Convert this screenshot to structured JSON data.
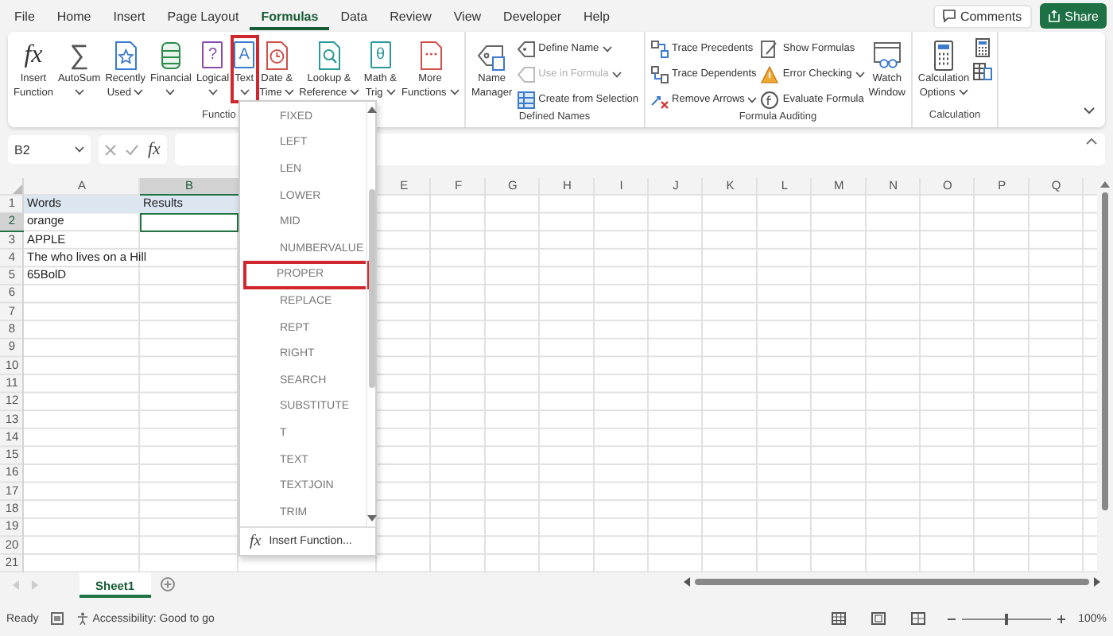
{
  "menu_tabs": [
    {
      "label": "File",
      "selected": false
    },
    {
      "label": "Home",
      "selected": false
    },
    {
      "label": "Insert",
      "selected": false
    },
    {
      "label": "Page Layout",
      "selected": false
    },
    {
      "label": "Formulas",
      "selected": true
    },
    {
      "label": "Data",
      "selected": false
    },
    {
      "label": "Review",
      "selected": false
    },
    {
      "label": "View",
      "selected": false
    },
    {
      "label": "Developer",
      "selected": false
    },
    {
      "label": "Help",
      "selected": false
    }
  ],
  "comments_button": "Comments",
  "share_button": "Share",
  "ribbon": {
    "groups": [
      {
        "label": "Functio",
        "items": [
          {
            "kind": "large",
            "icon_text": "fx",
            "lines": [
              "Insert",
              "Function"
            ],
            "dropdown": false,
            "highlighted": false
          },
          {
            "kind": "large",
            "icon_text": "∑",
            "lines": [
              "AutoSum"
            ],
            "dropdown": true,
            "highlighted": false
          },
          {
            "kind": "large",
            "lines": [
              "Recently",
              "Used"
            ],
            "dropdown": true,
            "highlighted": false
          },
          {
            "kind": "large",
            "lines": [
              "Financial"
            ],
            "dropdown": true,
            "highlighted": false
          },
          {
            "kind": "large",
            "icon_text": "?",
            "lines": [
              "Logical"
            ],
            "dropdown": true,
            "highlighted": false
          },
          {
            "kind": "large",
            "icon_text": "A",
            "lines": [
              "Text"
            ],
            "dropdown": true,
            "highlighted": true
          },
          {
            "kind": "large",
            "lines": [
              "Date &",
              "Time"
            ],
            "dropdown": true,
            "highlighted": false
          },
          {
            "kind": "large",
            "lines": [
              "Lookup &",
              "Reference"
            ],
            "dropdown": true,
            "highlighted": false
          },
          {
            "kind": "large",
            "icon_text": "θ",
            "lines": [
              "Math &",
              "Trig"
            ],
            "dropdown": true,
            "highlighted": false
          },
          {
            "kind": "large",
            "lines": [
              "More",
              "Functions"
            ],
            "dropdown": true,
            "highlighted": false
          }
        ]
      },
      {
        "label": "Defined Names",
        "items": [
          {
            "kind": "large",
            "lines": [
              "Name",
              "Manager"
            ],
            "dropdown": false,
            "highlighted": false
          },
          {
            "kind": "small",
            "label": "Define Name",
            "dropdown": true,
            "disabled": false
          },
          {
            "kind": "small",
            "label": "Use in Formula",
            "dropdown": true,
            "disabled": true
          },
          {
            "kind": "small",
            "label": "Create from Selection",
            "dropdown": false,
            "disabled": false
          }
        ]
      },
      {
        "label": "Formula Auditing",
        "items": [
          {
            "kind": "small",
            "label": "Trace Precedents",
            "dropdown": false,
            "disabled": false
          },
          {
            "kind": "small",
            "label": "Trace Dependents",
            "dropdown": false,
            "disabled": false
          },
          {
            "kind": "small",
            "label": "Remove Arrows",
            "dropdown": true,
            "disabled": false
          },
          {
            "kind": "small",
            "label": "Show Formulas",
            "dropdown": false,
            "disabled": false
          },
          {
            "kind": "small",
            "label": "Error Checking",
            "dropdown": true,
            "disabled": false
          },
          {
            "kind": "small",
            "label": "Evaluate Formula",
            "dropdown": false,
            "disabled": false
          },
          {
            "kind": "large",
            "lines": [
              "Watch",
              "Window"
            ],
            "dropdown": false,
            "highlighted": false
          }
        ]
      },
      {
        "label": "Calculation",
        "items": [
          {
            "kind": "large",
            "lines": [
              "Calculation",
              "Options"
            ],
            "dropdown": true,
            "highlighted": false
          },
          {
            "kind": "icon"
          },
          {
            "kind": "icon"
          }
        ]
      }
    ]
  },
  "formula_bar": {
    "name_box": "B2",
    "fx": "fx"
  },
  "sheet": {
    "columns": [
      "A",
      "B",
      "E",
      "F",
      "G",
      "H",
      "I",
      "J",
      "K",
      "L",
      "M",
      "N",
      "O",
      "P",
      "Q"
    ],
    "rows": [
      {
        "number": "1",
        "cells": [
          {
            "text": "Words",
            "selected": false,
            "highlighted": true
          },
          {
            "text": "Results",
            "selected": false,
            "highlighted": true
          }
        ]
      },
      {
        "number": "2",
        "cells": [
          {
            "text": "orange",
            "selected": false,
            "highlighted": false
          },
          {
            "selected": true,
            "highlighted": false
          }
        ]
      },
      {
        "number": "3",
        "cells": [
          {
            "text": "APPLE",
            "selected": false,
            "highlighted": false
          }
        ]
      },
      {
        "number": "4",
        "cells": [
          {
            "text": "The who lives on a Hill",
            "selected": false,
            "highlighted": false
          }
        ]
      },
      {
        "number": "5",
        "cells": [
          {
            "text": "65BolD",
            "selected": false,
            "highlighted": false
          }
        ]
      },
      {
        "number": "6"
      },
      {
        "number": "7"
      },
      {
        "number": "8"
      },
      {
        "number": "9"
      },
      {
        "number": "10"
      },
      {
        "number": "11"
      },
      {
        "number": "12"
      },
      {
        "number": "13"
      },
      {
        "number": "14"
      },
      {
        "number": "15"
      },
      {
        "number": "16"
      },
      {
        "number": "17"
      },
      {
        "number": "18"
      },
      {
        "number": "19"
      },
      {
        "number": "20"
      },
      {
        "number": "21"
      }
    ]
  },
  "text_menu": {
    "items": [
      {
        "label": "FIXED",
        "highlighted": false
      },
      {
        "label": "LEFT",
        "highlighted": false
      },
      {
        "label": "LEN",
        "highlighted": false
      },
      {
        "label": "LOWER",
        "highlighted": false
      },
      {
        "label": "MID",
        "highlighted": false
      },
      {
        "label": "NUMBERVALUE",
        "highlighted": false
      },
      {
        "label": "PROPER",
        "highlighted": true
      },
      {
        "label": "REPLACE",
        "highlighted": false
      },
      {
        "label": "REPT",
        "highlighted": false
      },
      {
        "label": "RIGHT",
        "highlighted": false
      },
      {
        "label": "SEARCH",
        "highlighted": false
      },
      {
        "label": "SUBSTITUTE",
        "highlighted": false
      },
      {
        "label": "T",
        "highlighted": false
      },
      {
        "label": "TEXT",
        "highlighted": false
      },
      {
        "label": "TEXTJOIN",
        "highlighted": false
      },
      {
        "label": "TRIM",
        "highlighted": false
      }
    ],
    "footer_icon": "fx",
    "footer": "Insert Function..."
  },
  "sheet_tabs": [
    {
      "label": "Sheet1",
      "selected": true
    }
  ],
  "status_bar": {
    "status": "Ready",
    "accessibility": "Accessibility: Good to go",
    "zoom": "100%",
    "zoom_level": {
      "level": 0.5
    }
  }
}
